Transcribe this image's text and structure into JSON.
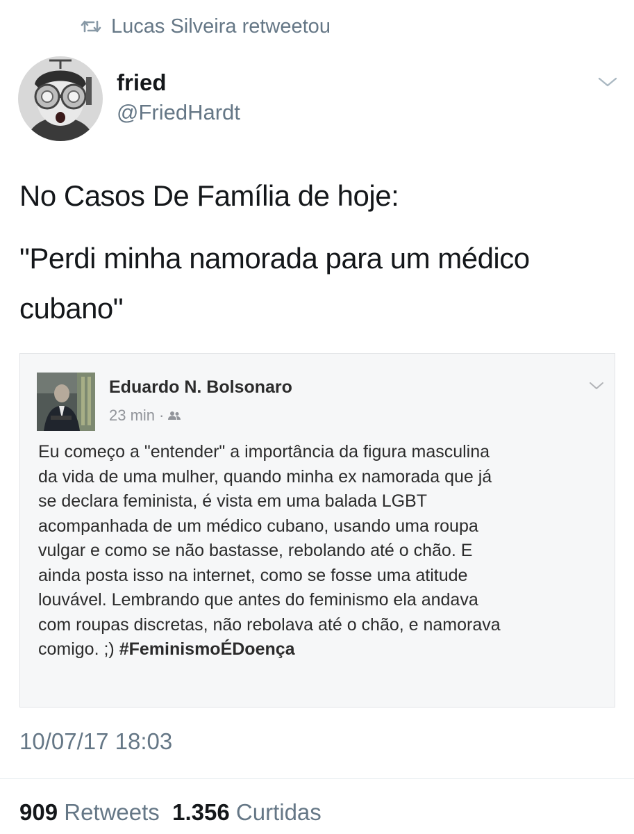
{
  "retweet_bar": {
    "text": "Lucas Silveira retweetou",
    "icon": "retweet-icon"
  },
  "author": {
    "display_name": "fried",
    "handle": "@FriedHardt"
  },
  "tweet": {
    "lines": [
      "No Casos De Família de hoje:",
      "\"Perdi minha namorada para um médico",
      "cubano\""
    ]
  },
  "embedded_post": {
    "author_name": "Eduardo N. Bolsonaro",
    "time": "23 min",
    "separator": "·",
    "audience_icon": "friends-icon",
    "body_lines": [
      "Eu começo a \"entender\" a importância da figura masculina",
      "da vida de uma mulher, quando minha ex namorada que já",
      "se declara feminista, é vista em uma balada LGBT",
      "acompanhada de um médico cubano, usando uma roupa",
      "vulgar e como se não bastasse, rebolando até o chão. E",
      "ainda posta isso na internet, como se fosse uma atitude",
      "louvável. Lembrando que antes do feminismo ela andava",
      "com roupas discretas, não rebolava até o chão, e namorava"
    ],
    "last_line_text": "comigo. ;) ",
    "hashtag": "#FeminismoÉDoença"
  },
  "timestamp": "10/07/17 18:03",
  "stats": {
    "retweets_count": "909",
    "retweets_label": "Retweets",
    "likes_count": "1.356",
    "likes_label": "Curtidas"
  },
  "colors": {
    "text": "#14171a",
    "secondary": "#657786",
    "divider": "#e6ecf0"
  }
}
